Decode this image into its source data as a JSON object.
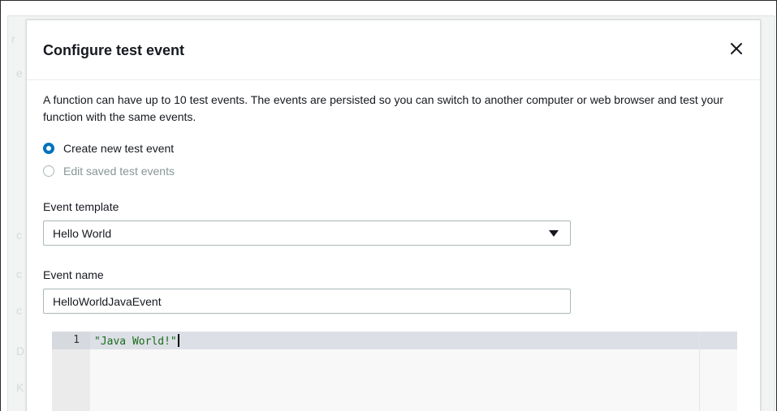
{
  "modal": {
    "title": "Configure test event",
    "description": "A function can have up to 10 test events. The events are persisted so you can switch to another computer or web browser and test your function with the same events."
  },
  "mode": {
    "options": [
      {
        "label": "Create new test event",
        "selected": true,
        "enabled": true
      },
      {
        "label": "Edit saved test events",
        "selected": false,
        "enabled": false
      }
    ]
  },
  "event_template": {
    "label": "Event template",
    "value": "Hello World"
  },
  "event_name": {
    "label": "Event name",
    "value": "HelloWorldJavaEvent"
  },
  "editor": {
    "lines": [
      {
        "number": "1",
        "text": "\"Java World!\""
      }
    ]
  },
  "colors": {
    "accent": "#0073bb",
    "code_string": "#1a6b1a",
    "active_line": "#dcdfe6"
  },
  "icons": {
    "close": "close-icon",
    "select_caret": "caret-down-icon"
  }
}
